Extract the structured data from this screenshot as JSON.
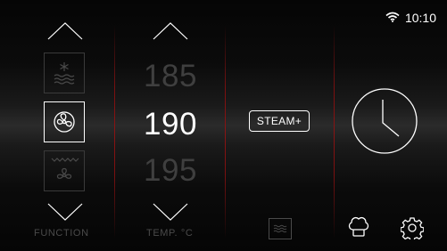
{
  "status": {
    "time": "10:10",
    "wifi_icon": "wifi-icon"
  },
  "function": {
    "label": "FUNCTION",
    "items": [
      {
        "icon": "defrost-icon",
        "state": "dim"
      },
      {
        "icon": "fan-icon",
        "state": "selected"
      },
      {
        "icon": "top-heat-fan-icon",
        "state": "dim"
      }
    ]
  },
  "temperature": {
    "label": "TEMP. °C",
    "values": [
      "185",
      "190",
      "195"
    ],
    "selected": "190"
  },
  "steam": {
    "label": "STEAM+"
  },
  "icons": {
    "clock": "clock-icon",
    "heater": "heater-icon",
    "chef": "chef-hat-icon",
    "settings": "gear-icon"
  }
}
